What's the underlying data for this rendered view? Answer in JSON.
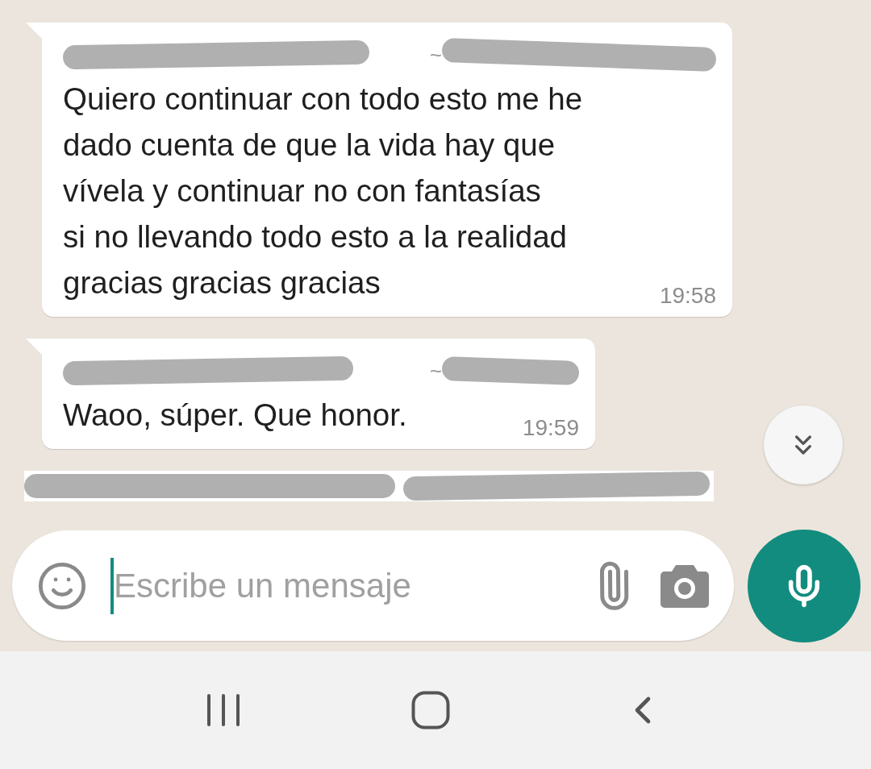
{
  "messages": [
    {
      "sender_marker": "~",
      "text": "Quiero continuar con todo esto me he\ndado cuenta de que la vida hay que\nvívela y continuar no con fantasías\nsi no llevando todo esto a la realidad\ngracias gracias gracias",
      "time": "19:58"
    },
    {
      "sender_marker": "~",
      "text": "Waoo, súper. Que honor.",
      "time": "19:59"
    }
  ],
  "composer": {
    "placeholder": "Escribe un mensaje"
  }
}
